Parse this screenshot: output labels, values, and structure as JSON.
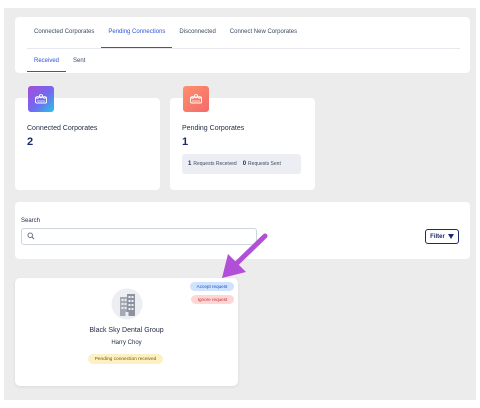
{
  "tabs": [
    {
      "label": "Connected Corporates",
      "active": false
    },
    {
      "label": "Pending Connections",
      "active": true
    },
    {
      "label": "Disconnected",
      "active": false
    },
    {
      "label": "Connect New Corporates",
      "active": false
    }
  ],
  "subtabs": [
    {
      "label": "Received",
      "active": true
    },
    {
      "label": "Sent",
      "active": false
    }
  ],
  "stats": {
    "connected": {
      "label": "Connected Corporates",
      "value": "2",
      "icon": "corporates-icon"
    },
    "pending": {
      "label": "Pending Corporates",
      "value": "1",
      "icon": "corporates-icon",
      "received_count": "1",
      "received_label": "Requests Received",
      "sent_count": "0",
      "sent_label": "Requests Sent"
    }
  },
  "search": {
    "label": "Search",
    "placeholder": "",
    "value": ""
  },
  "filter": {
    "label": "Filter",
    "icon": "filter-icon"
  },
  "corporate_card": {
    "name": "Black Sky Dental Group",
    "person": "Harry Choy",
    "status": "Pending connection received",
    "accept_label": "Accept request",
    "ignore_label": "Ignore request",
    "icon": "building-icon"
  },
  "annotation": {
    "icon": "arrow-icon",
    "color": "#b24fd8"
  },
  "colors": {
    "accent": "#2f55d4",
    "navy": "#1b2a6b",
    "background": "#ececec"
  }
}
